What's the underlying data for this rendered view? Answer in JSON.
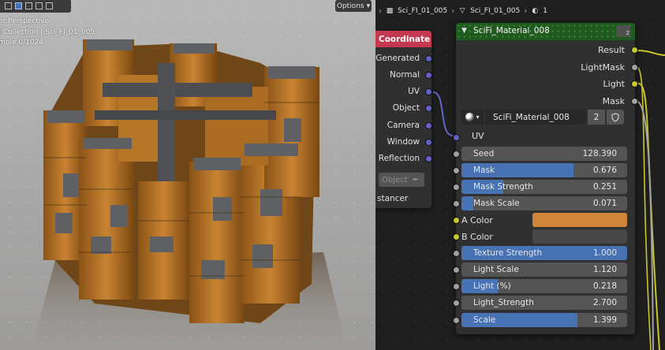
{
  "viewport": {
    "options_label": "Options",
    "info_lines": [
      "er Perspective",
      "| Collection | Sci_FI_01_005",
      "mple 0/1024"
    ]
  },
  "breadcrumb": {
    "object_name": "Sci_FI_01_005",
    "mesh_name": "Sci_FI_01_005",
    "material_slot": "1"
  },
  "texture_coordinate_node": {
    "title": "Coordinate",
    "outputs": [
      "Generated",
      "Normal",
      "UV",
      "Object",
      "Camera",
      "Window",
      "Reflection"
    ],
    "object_field_placeholder": "Object",
    "instancer_label": "stancer"
  },
  "group_node": {
    "title": "SciFi_Material_008",
    "badge": "2",
    "outputs": [
      "Result",
      "LightMask",
      "Light",
      "Mask"
    ],
    "datablock": {
      "name": "SciFi_Material_008",
      "users": "2"
    },
    "uv_input": "UV",
    "inputs": [
      {
        "label": "Seed",
        "value": "128.390",
        "fill": 0
      },
      {
        "label": "Mask",
        "value": "0.676",
        "fill": 0.676
      },
      {
        "label": "Mask Strength",
        "value": "0.251",
        "fill": 0.251
      },
      {
        "label": "Mask Scale",
        "value": "0.071",
        "fill": 0.071
      },
      {
        "label": "A Color",
        "color": "#d0863a"
      },
      {
        "label": "B Color",
        "color": "#474747"
      },
      {
        "label": "Texture Strength",
        "value": "1.000",
        "fill": 1
      },
      {
        "label": "Light Scale",
        "value": "1.120",
        "fill": 0
      },
      {
        "label": "Light (%)",
        "value": "0.218",
        "fill": 0.218
      },
      {
        "label": "Light_Strength",
        "value": "2.700",
        "fill": 0
      },
      {
        "label": "Scale",
        "value": "1.399",
        "fill": 0.7
      }
    ]
  },
  "colors": {
    "texture_node_header": "#c4394f",
    "group_node_header": "#1f5b1f",
    "slider_fill": "#4772b3",
    "vector_socket": "#6363c7",
    "color_socket": "#c7c729",
    "float_socket": "#a1a1a1"
  }
}
